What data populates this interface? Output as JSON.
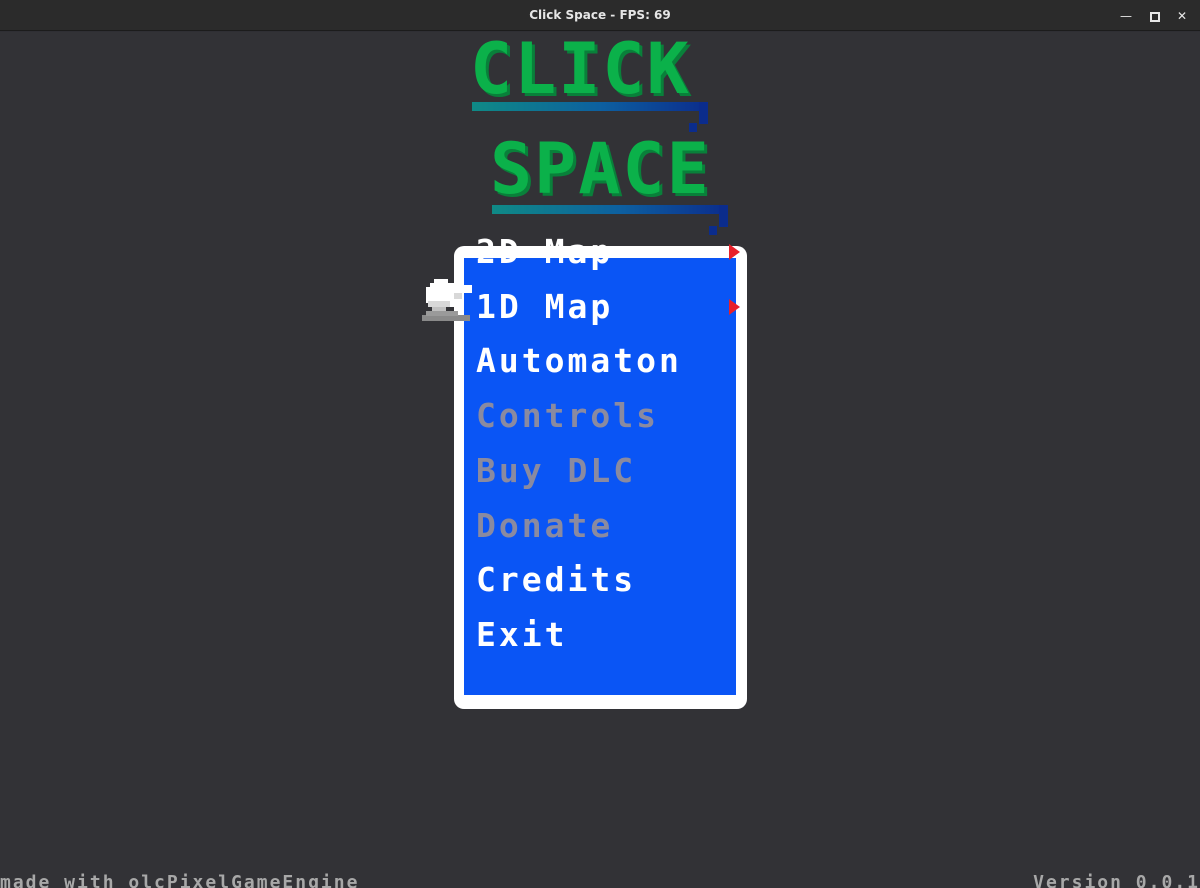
{
  "window": {
    "title": "Click Space - FPS: 69",
    "controls": [
      {
        "name": "minimize",
        "icon": "minimize-icon"
      },
      {
        "name": "maximize",
        "icon": "maximize-icon"
      },
      {
        "name": "close",
        "icon": "close-icon"
      }
    ]
  },
  "logo": {
    "line1": "CLICK",
    "line2": "SPACE",
    "color": "#0bb14a"
  },
  "menu": {
    "items": [
      {
        "label": "2D Map",
        "enabled": true,
        "has_submenu": true,
        "selected": true
      },
      {
        "label": "1D Map",
        "enabled": true,
        "has_submenu": true,
        "selected": false
      },
      {
        "label": "Automaton",
        "enabled": true,
        "has_submenu": false,
        "selected": false
      },
      {
        "label": "Controls",
        "enabled": false,
        "has_submenu": false,
        "selected": false
      },
      {
        "label": "Buy DLC",
        "enabled": false,
        "has_submenu": false,
        "selected": false
      },
      {
        "label": "Donate",
        "enabled": false,
        "has_submenu": false,
        "selected": false
      },
      {
        "label": "Credits",
        "enabled": true,
        "has_submenu": false,
        "selected": false
      },
      {
        "label": "Exit",
        "enabled": true,
        "has_submenu": false,
        "selected": false
      }
    ],
    "panel_color": "#0a55f5",
    "frame_color": "#ffffff",
    "disabled_color": "#8a8aa0",
    "arrow_color": "#e8202a",
    "cursor_icon": "pointing-hand-icon"
  },
  "footer": {
    "left": "made with olcPixelGameEngine",
    "right": "Version 0.0.1"
  }
}
